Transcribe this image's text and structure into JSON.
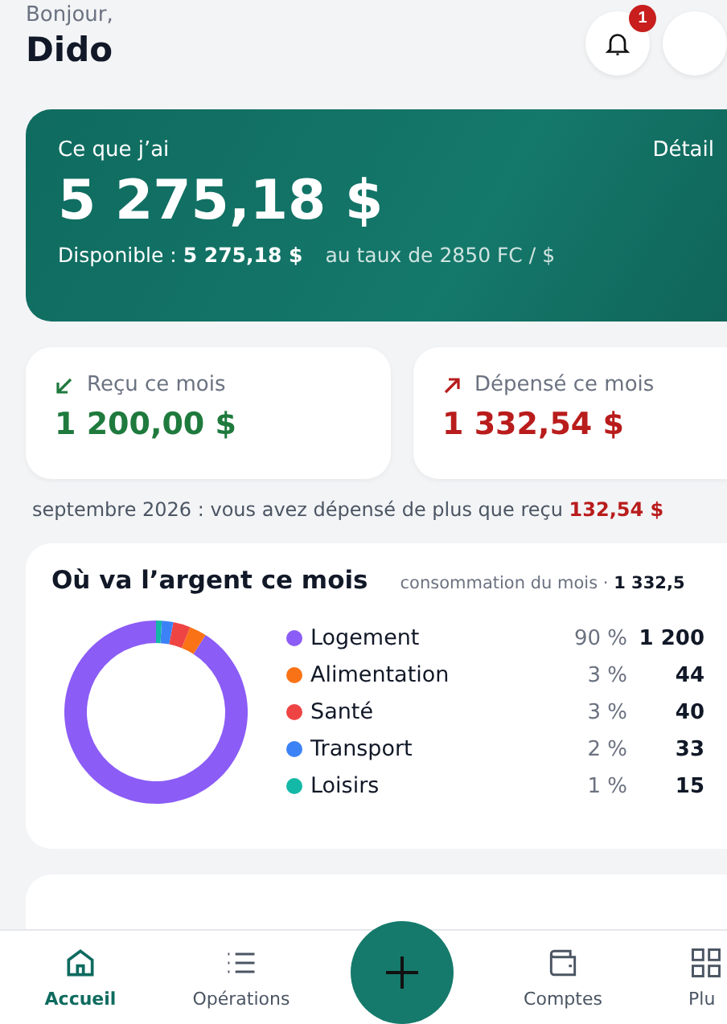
{
  "header": {
    "greeting": "Bonjour,",
    "name": "Dido",
    "notifications": {
      "badge": "1"
    }
  },
  "balance_card": {
    "label": "Ce que j’ai",
    "link": "Détail",
    "amount": "5 275,18 $",
    "available_label": "Disponible :",
    "available_amount": "5 275,18 $",
    "rate": "au taux de 2850 FC / $"
  },
  "stats": [
    {
      "kind": "in",
      "label": "Reçu ce mois",
      "amount": "1 200,00 $"
    },
    {
      "kind": "out",
      "label": "Dépensé ce mois",
      "amount": "1 332,54 $"
    }
  ],
  "summary": "septembre 2026 : vous avez dépensé de plus que reçu **132,54 $**",
  "spending": {
    "title": "Où va l’argent ce mois",
    "subtitle": "consommation du mois · **1 332,5**",
    "chart_data": {
      "type": "donut",
      "categories": [
        "Logement",
        "Alimentation",
        "Santé",
        "Transport",
        "Loisirs"
      ],
      "values": [
        90,
        3,
        3,
        2,
        1
      ],
      "colors": [
        "#8b5cf6",
        "#f97316",
        "#ef4444",
        "#3b82f6",
        "#14b8a6"
      ]
    },
    "legend": [
      {
        "percent": "90 %",
        "amount": "1 200"
      },
      {
        "percent": "3 %",
        "amount": "44"
      },
      {
        "percent": "3 %",
        "amount": "40"
      },
      {
        "percent": "2 %",
        "amount": "33"
      },
      {
        "percent": "1 %",
        "amount": "15"
      }
    ]
  },
  "nav": [
    {
      "kind": "home",
      "label": "Accueil",
      "selected": true
    },
    {
      "kind": "list",
      "label": "Opérations",
      "selected": false
    },
    {
      "kind": "add"
    },
    {
      "kind": "wallet",
      "label": "Comptes",
      "selected": false
    },
    {
      "kind": "grid",
      "label": "Plu",
      "selected": false
    }
  ]
}
